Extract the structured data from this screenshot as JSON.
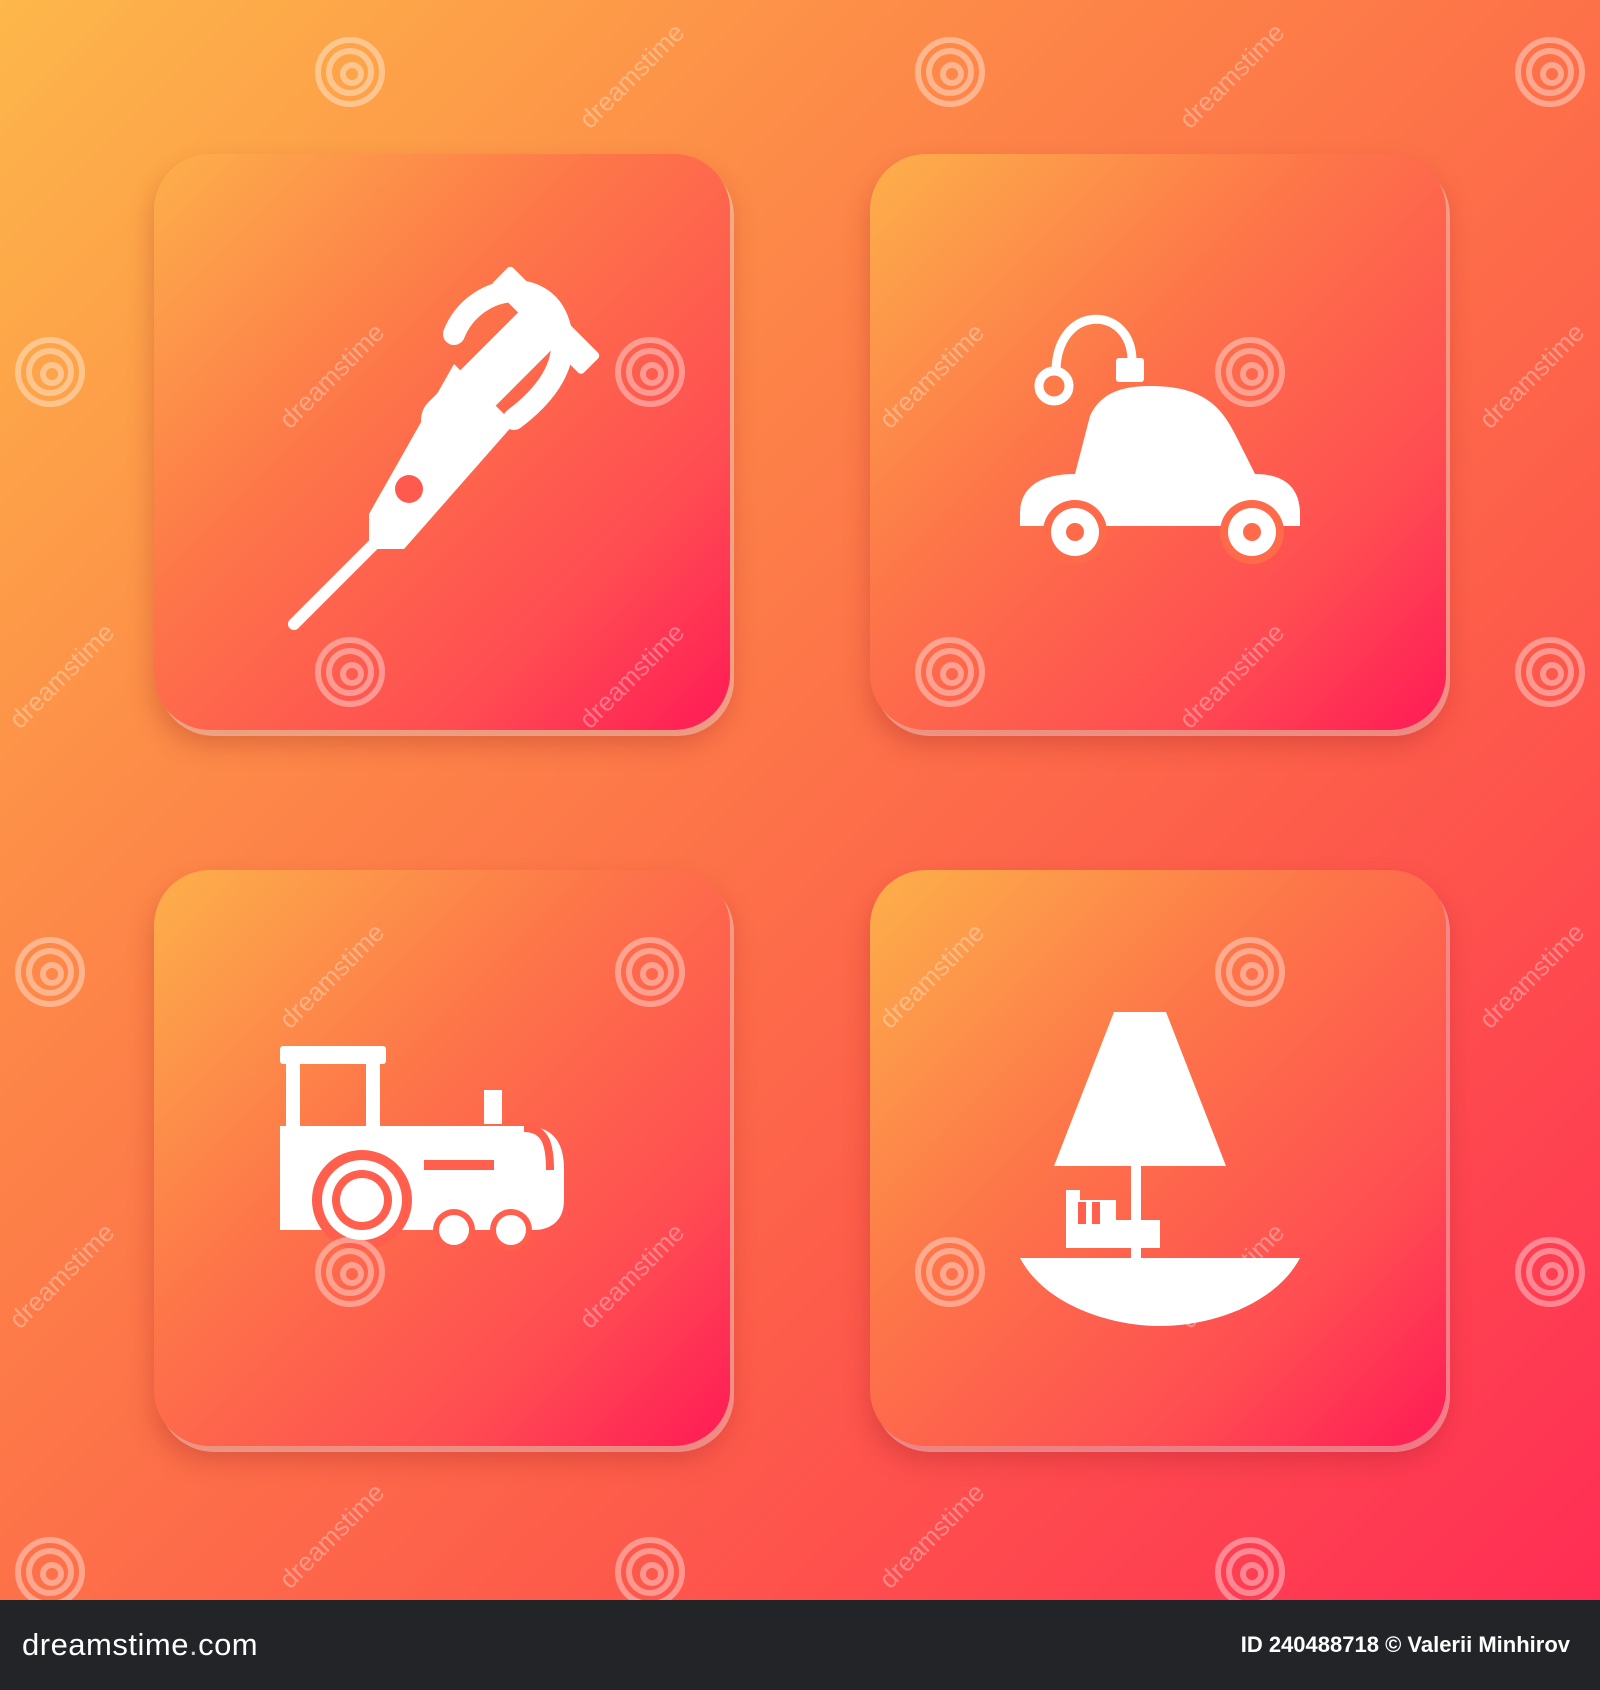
{
  "colors": {
    "background_top_left": "#fdb74a",
    "background_bottom_right": "#ff2d55",
    "icon_fill": "#ffffff",
    "footer_background": "#232428"
  },
  "tiles": [
    {
      "icon": "microphone-icon"
    },
    {
      "icon": "toy-car-icon"
    },
    {
      "icon": "toy-train-icon"
    },
    {
      "icon": "floor-lamp-icon"
    }
  ],
  "watermark": {
    "text": "dreamstime",
    "icon": "spiral-logo-icon"
  },
  "footer": {
    "brand_left": "dreamstime",
    "brand_right": "com",
    "id_text": "ID 240488718",
    "copyright_text": "© Valerii Minhirov"
  }
}
